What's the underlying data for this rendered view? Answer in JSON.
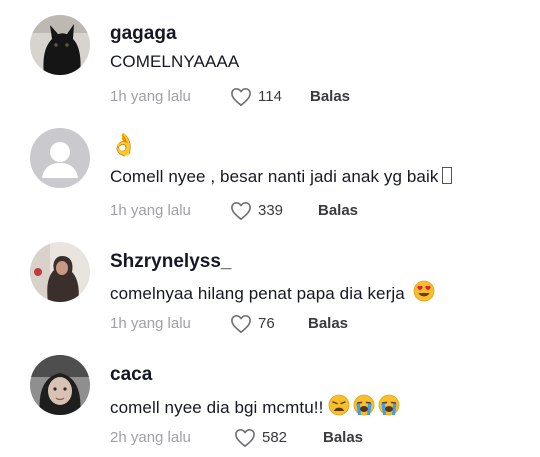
{
  "comments": [
    {
      "username": "gagaga",
      "text": "COMELNYAAAA",
      "time": "1h yang lalu",
      "likes": "114",
      "reply_label": "Balas",
      "avatar_icon": "black-cat-avatar"
    },
    {
      "username": "👌",
      "text": "Comell nyee , besar nanti jadi anak yg baik",
      "time": "1h yang lalu",
      "likes": "339",
      "reply_label": "Balas",
      "avatar_icon": "default-user-avatar"
    },
    {
      "username": "Shzrynelyss_",
      "text": "comelnyaa hilang penat papa dia kerja",
      "time": "1h yang lalu",
      "likes": "76",
      "reply_label": "Balas",
      "avatar_icon": "photo-avatar"
    },
    {
      "username": "caca",
      "text": "comell nyee dia bgi mcmtu!!",
      "time": "2h yang lalu",
      "likes": "582",
      "reply_label": "Balas",
      "avatar_icon": "photo-avatar"
    }
  ],
  "colors": {
    "text": "#161823",
    "secondary": "#a0a0a5",
    "default_avatar_bg": "#c9c9ce"
  }
}
